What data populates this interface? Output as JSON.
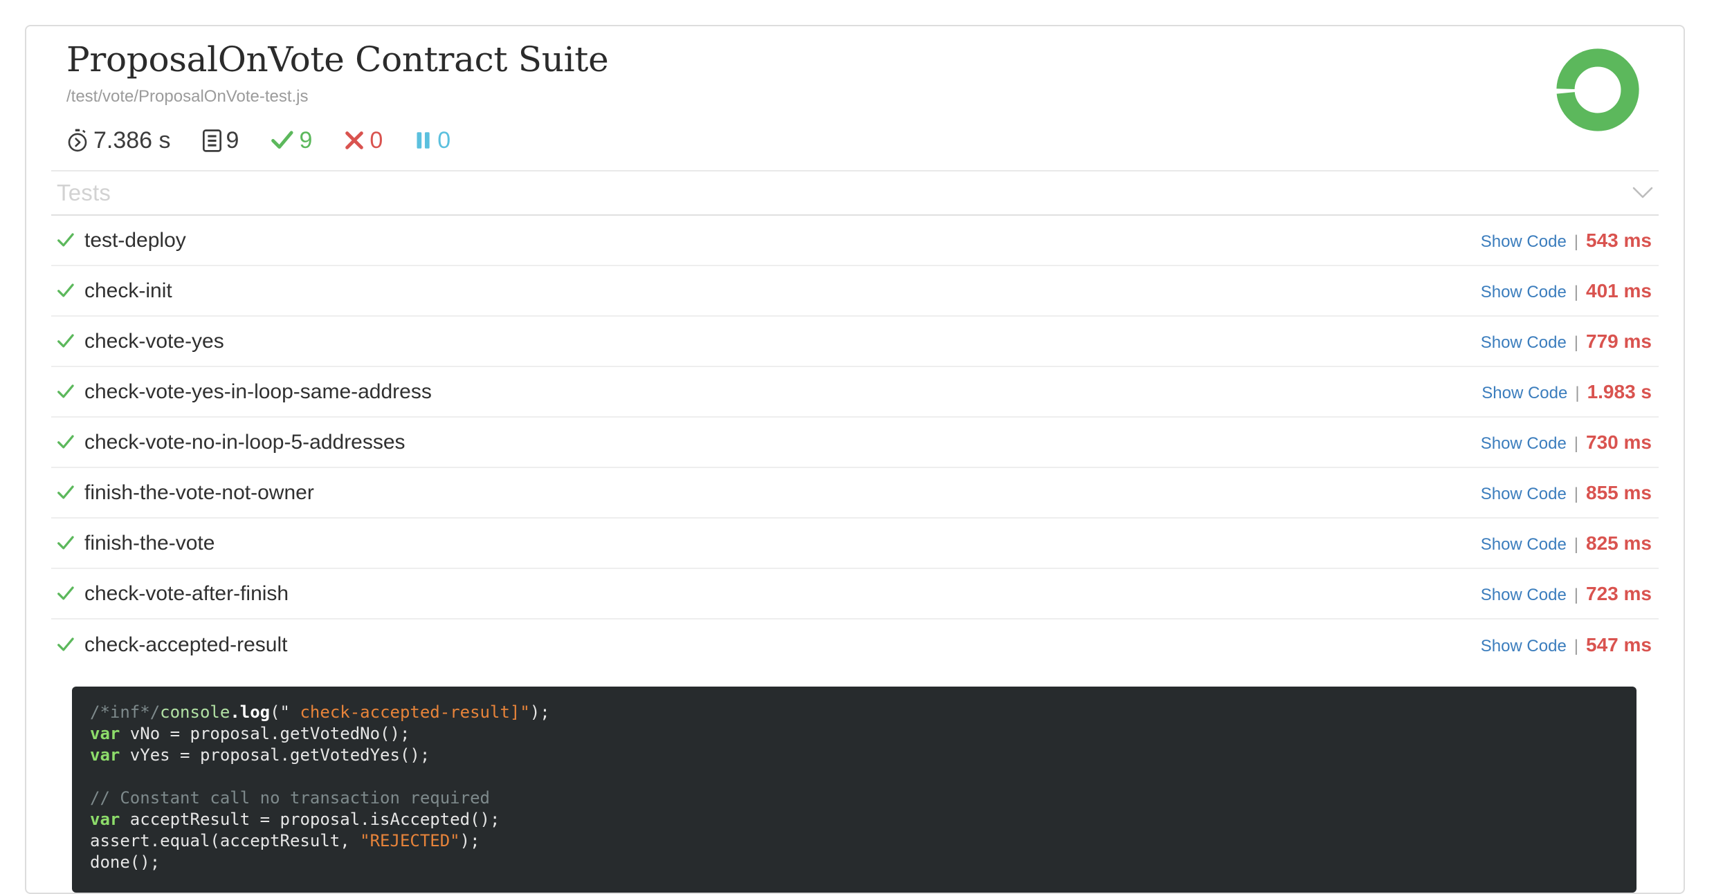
{
  "suite": {
    "title": "ProposalOnVote Contract Suite",
    "path": "/test/vote/ProposalOnVote-test.js"
  },
  "summary": {
    "duration": "7.386 s",
    "total": "9",
    "passed": "9",
    "failed": "0",
    "skipped": "0",
    "duration_icon": "stopwatch-icon",
    "total_icon": "document-list-icon",
    "passed_icon": "check-icon",
    "failed_icon": "cross-icon",
    "skipped_icon": "pause-icon",
    "donut": {
      "icon": "pass-ratio-donut",
      "percent": 100,
      "color": "#5cb85c"
    }
  },
  "section": {
    "title": "Tests",
    "collapse_icon": "chevron-down-icon"
  },
  "tests": [
    {
      "status": "passed",
      "name": "test-deploy",
      "show_code": "Show Code",
      "separator": "|",
      "duration": "543 ms"
    },
    {
      "status": "passed",
      "name": "check-init",
      "show_code": "Show Code",
      "separator": "|",
      "duration": "401 ms"
    },
    {
      "status": "passed",
      "name": "check-vote-yes",
      "show_code": "Show Code",
      "separator": "|",
      "duration": "779 ms"
    },
    {
      "status": "passed",
      "name": "check-vote-yes-in-loop-same-address",
      "show_code": "Show Code",
      "separator": "|",
      "duration": "1.983 s"
    },
    {
      "status": "passed",
      "name": "check-vote-no-in-loop-5-addresses",
      "show_code": "Show Code",
      "separator": "|",
      "duration": "730 ms"
    },
    {
      "status": "passed",
      "name": "finish-the-vote-not-owner",
      "show_code": "Show Code",
      "separator": "|",
      "duration": "855 ms"
    },
    {
      "status": "passed",
      "name": "finish-the-vote",
      "show_code": "Show Code",
      "separator": "|",
      "duration": "825 ms"
    },
    {
      "status": "passed",
      "name": "check-vote-after-finish",
      "show_code": "Show Code",
      "separator": "|",
      "duration": "723 ms"
    },
    {
      "status": "passed",
      "name": "check-accepted-result",
      "show_code": "Show Code",
      "separator": "|",
      "duration": "547 ms"
    }
  ],
  "code_panel": {
    "for_test": "check-accepted-result",
    "lines": [
      [
        {
          "t": "/*inf*/",
          "c": "c-comment"
        },
        {
          "t": "console",
          "c": "c-object"
        },
        {
          "t": ".log",
          "c": "c-fn"
        },
        {
          "t": "(\" ",
          "c": "c-plain"
        },
        {
          "t": "check-accepted-result]\"",
          "c": "c-string"
        },
        {
          "t": ");",
          "c": "c-plain"
        }
      ],
      [
        {
          "t": "var",
          "c": "c-keyword"
        },
        {
          "t": " vNo = proposal.getVotedNo();",
          "c": "c-plain"
        }
      ],
      [
        {
          "t": "var",
          "c": "c-keyword"
        },
        {
          "t": " vYes = proposal.getVotedYes();",
          "c": "c-plain"
        }
      ],
      [
        {
          "t": "",
          "c": "c-plain"
        }
      ],
      [
        {
          "t": "// Constant call no transaction required",
          "c": "c-comment"
        }
      ],
      [
        {
          "t": "var",
          "c": "c-keyword"
        },
        {
          "t": " acceptResult = proposal.isAccepted();",
          "c": "c-plain"
        }
      ],
      [
        {
          "t": "assert.equal(acceptResult, ",
          "c": "c-plain"
        },
        {
          "t": "\"REJECTED\"",
          "c": "c-string"
        },
        {
          "t": ");",
          "c": "c-plain"
        }
      ],
      [
        {
          "t": "done();",
          "c": "c-plain"
        }
      ]
    ]
  },
  "colors": {
    "pass": "#5cb85c",
    "fail": "#d9534f",
    "skip": "#5bc0de",
    "link": "#3b7dbd",
    "code_bg": "#272b2d"
  }
}
